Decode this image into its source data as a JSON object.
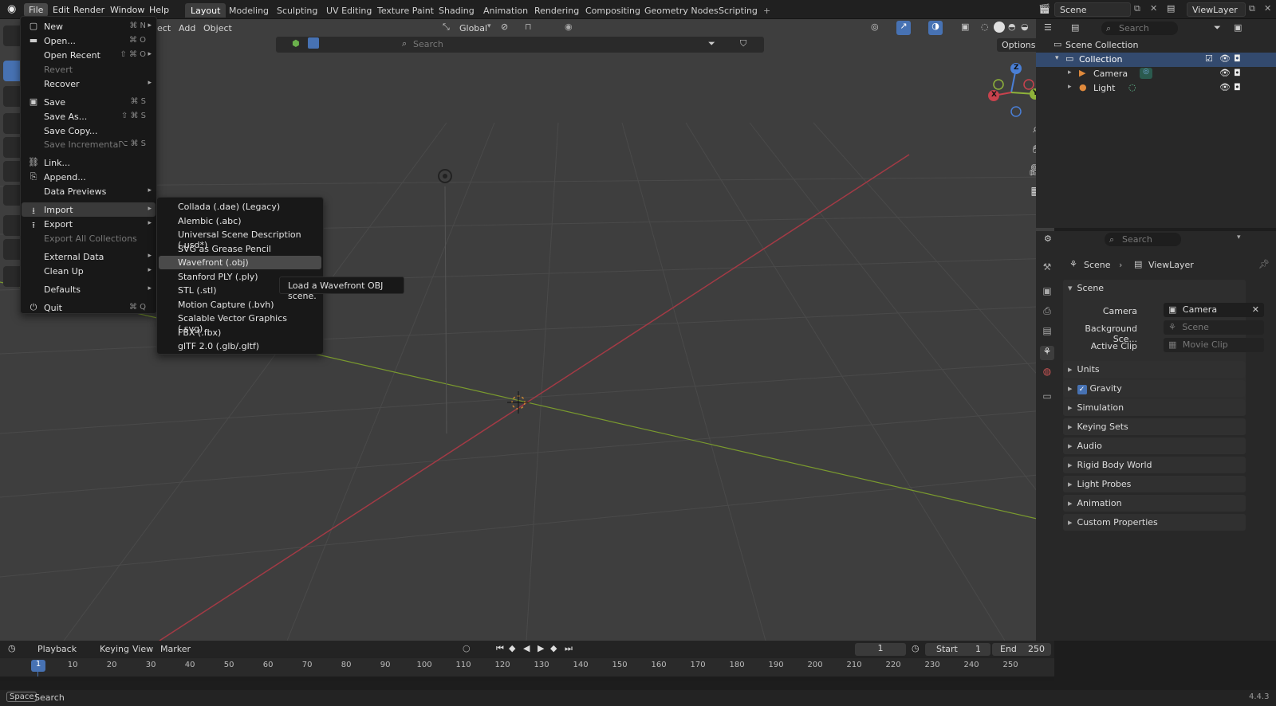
{
  "topbar": {
    "menus": [
      "File",
      "Edit",
      "Render",
      "Window",
      "Help"
    ],
    "workspaces": [
      "Layout",
      "Modeling",
      "Sculpting",
      "UV Editing",
      "Texture Paint",
      "Shading",
      "Animation",
      "Rendering",
      "Compositing",
      "Geometry Nodes",
      "Scripting"
    ],
    "add_tab": "+",
    "scene": "Scene",
    "view_layer": "ViewLayer"
  },
  "viewport": {
    "header_items": [
      "ect",
      "Add",
      "Object"
    ],
    "orientation": "Global",
    "search_placeholder": "Search",
    "options": "Options"
  },
  "file_menu": {
    "items": [
      {
        "label": "New",
        "shortcut": "⌘ N",
        "icon": "new-file-icon"
      },
      {
        "label": "Open...",
        "shortcut": "⌘ O",
        "icon": "folder-icon"
      },
      {
        "label": "Open Recent",
        "shortcut": "⇧ ⌘ O"
      },
      {
        "label": "Revert",
        "disabled": true
      },
      {
        "label": "Recover"
      },
      {
        "label": "Save",
        "shortcut": "⌘ S",
        "icon": "save-icon"
      },
      {
        "label": "Save As...",
        "shortcut": "⇧ ⌘ S"
      },
      {
        "label": "Save Copy..."
      },
      {
        "label": "Save Incremental",
        "shortcut": "⌥ ⌘ S",
        "disabled": true
      },
      {
        "label": "Link...",
        "icon": "link-icon"
      },
      {
        "label": "Append...",
        "icon": "append-icon"
      },
      {
        "label": "Data Previews"
      },
      {
        "label": "Import",
        "icon": "import-icon"
      },
      {
        "label": "Export",
        "icon": "export-icon"
      },
      {
        "label": "Export All Collections",
        "disabled": true
      },
      {
        "label": "External Data"
      },
      {
        "label": "Clean Up"
      },
      {
        "label": "Defaults"
      },
      {
        "label": "Quit",
        "shortcut": "⌘ Q",
        "icon": "power-icon"
      }
    ]
  },
  "import_menu": {
    "items": [
      "Collada (.dae) (Legacy)",
      "Alembic (.abc)",
      "Universal Scene Description (.usd*)",
      "SVG as Grease Pencil",
      "Wavefront (.obj)",
      "Stanford PLY (.ply)",
      "STL (.stl)",
      "Motion Capture (.bvh)",
      "Scalable Vector Graphics (.svg)",
      "FBX (.fbx)",
      "glTF 2.0 (.glb/.gltf)"
    ],
    "highlighted": "Wavefront (.obj)",
    "tooltip": "Load a Wavefront OBJ scene."
  },
  "gizmo": {
    "z": "Z",
    "y": "Y",
    "x": "X"
  },
  "outliner": {
    "search_placeholder": "Search",
    "scene_collection": "Scene Collection",
    "collection": "Collection",
    "items": [
      "Camera",
      "Light"
    ]
  },
  "properties": {
    "search_placeholder": "Search",
    "breadcrumb_scene": "Scene",
    "breadcrumb_viewlayer": "ViewLayer",
    "panel_scene": "Scene",
    "camera_label": "Camera",
    "camera_value": "Camera",
    "background_label": "Background Sce...",
    "background_value": "Scene",
    "clip_label": "Active Clip",
    "clip_value": "Movie Clip",
    "panels": [
      "Units",
      "Gravity",
      "Simulation",
      "Keying Sets",
      "Audio",
      "Rigid Body World",
      "Light Probes",
      "Animation",
      "Custom Properties"
    ]
  },
  "timeline": {
    "menus": [
      "Playback",
      "Keying",
      "View",
      "Marker"
    ],
    "current_frame": "1",
    "start_label": "Start",
    "start": "1",
    "end_label": "End",
    "end": "250",
    "ticks": [
      "1",
      "10",
      "20",
      "30",
      "40",
      "50",
      "60",
      "70",
      "80",
      "90",
      "100",
      "110",
      "120",
      "130",
      "140",
      "150",
      "160",
      "170",
      "180",
      "190",
      "200",
      "210",
      "220",
      "230",
      "240",
      "250"
    ]
  },
  "status": {
    "key": "Space",
    "action": "Search",
    "version": "4.4.3"
  },
  "colors": {
    "accent": "#4772b3",
    "x_axis": "#c8424d",
    "y_axis": "#8fb33a",
    "z_axis": "#4a7fd6"
  }
}
